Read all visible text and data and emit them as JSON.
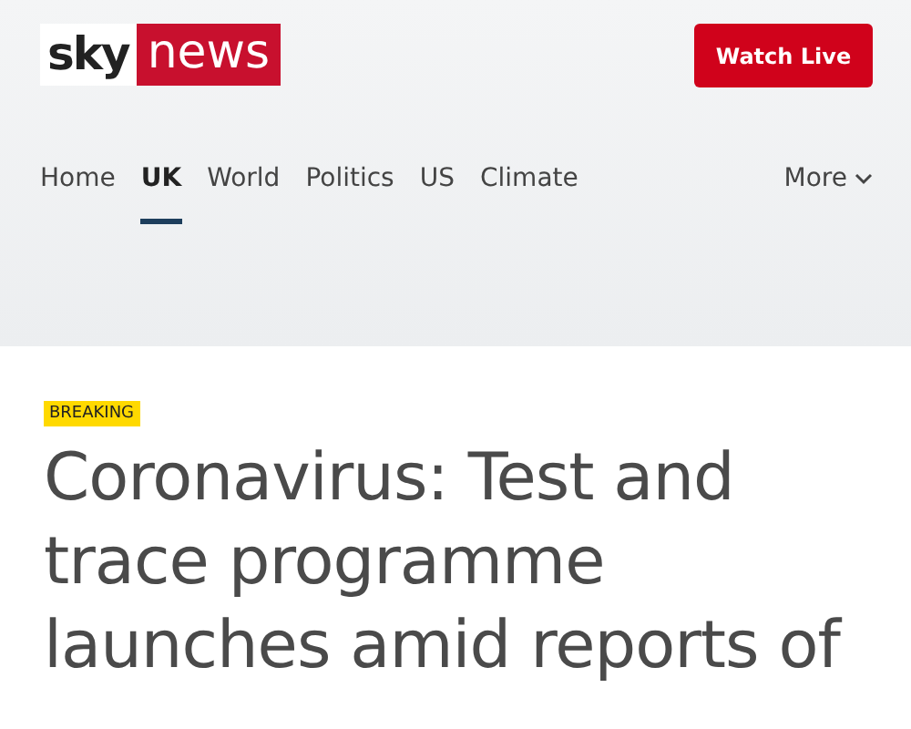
{
  "logo": {
    "part_1": "sky",
    "part_2": "news"
  },
  "watch_button": "Watch Live",
  "nav": [
    {
      "label": "Home",
      "selected": false
    },
    {
      "label": "UK",
      "selected": true
    },
    {
      "label": "World",
      "selected": false
    },
    {
      "label": "Politics",
      "selected": false
    },
    {
      "label": "US",
      "selected": false
    },
    {
      "label": "Climate",
      "selected": false
    }
  ],
  "more": {
    "label": "More",
    "expanded": false
  },
  "article": {
    "badge": "BREAKING",
    "headline": "Coronavirus: Test and trace programme launches amid reports of"
  }
}
